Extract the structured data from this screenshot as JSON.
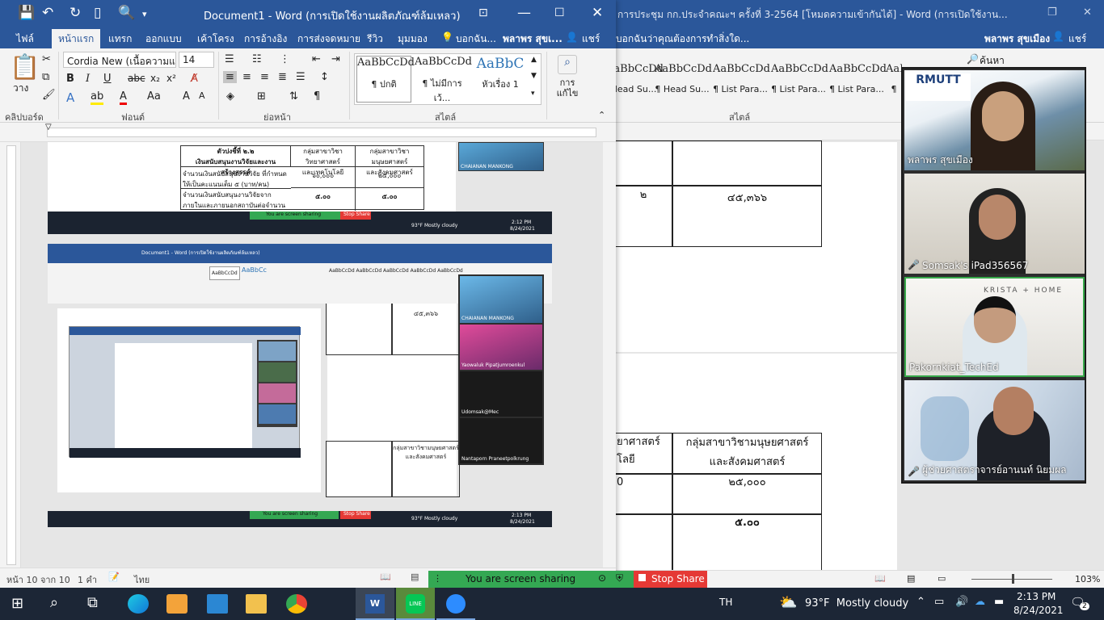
{
  "fg_window": {
    "title": "Document1 - Word (การเปิดใช้งานผลิตภัณฑ์ล้มเหลว)",
    "tabs": [
      "ไฟล์",
      "หน้าแรก",
      "แทรก",
      "ออกแบบ",
      "เค้าโครง",
      "การอ้างอิง",
      "การส่งจดหมาย",
      "รีวิว",
      "มุมมอง",
      "บอกฉัน...",
      "พลาพร สุขเ...",
      "แชร์"
    ],
    "font_name": "Cordia New (เนื้อความแบบ",
    "font_size": "14",
    "groups": [
      "คลิปบอร์ด",
      "ฟอนต์",
      "ย่อหน้า",
      "สไตล์",
      "การแก้ไข"
    ],
    "paste_label": "วาง",
    "styles": [
      {
        "sample": "AaBbCcDd",
        "name": "¶ ปกติ"
      },
      {
        "sample": "AaBbCcDd",
        "name": "¶ ไม่มีการเว้..."
      },
      {
        "sample": "AaBbC",
        "name": "หัวเรื่อง 1"
      }
    ],
    "editing_label": "การ แก้ไข",
    "status": {
      "page": "หน้า 10 จาก 10",
      "words": "1 คำ",
      "lang": "ไทย"
    }
  },
  "bg_window": {
    "title": "การประชุม กก.ประจำคณะฯ ครั้งที่ 3-2564 [โหมดความเข้ากันได้] - Word (การเปิดใช้งาน...",
    "tell_me": "บอกฉันว่าคุณต้องการทำสิ่งใด...",
    "user": "พลาพร สุขเมือง",
    "share": "แชร์",
    "search": "ค้นหา",
    "styles": [
      {
        "sample": "AaBbCcDd",
        "name": "Head Su..."
      },
      {
        "sample": "AaBbCcDd",
        "name": "¶ Head Su..."
      },
      {
        "sample": "AaBbCcDd",
        "name": "¶ List Para..."
      },
      {
        "sample": "AaBbCcDd",
        "name": "¶ List Para..."
      },
      {
        "sample": "AaBbCcDd",
        "name": "¶ List Para..."
      },
      {
        "sample": "AaBbCcDd",
        "name": "¶ ..."
      }
    ],
    "group_style": "สไตล์",
    "table_top": {
      "c1": "๒",
      "c2": "๔๕,๓๖๖"
    },
    "table_bottom": {
      "h1": "ยาศาสตร์\nโลยี",
      "h2": "กลุ่มสาขาวิชามนุษยศาสตร์\nและสังคมศาสตร์",
      "r1c1": "0",
      "r1c2": "๒๕,๐๐๐",
      "r2c2": "๕.๐๐"
    },
    "zoom": "103%"
  },
  "doc_snippet": {
    "header": "ตัวบ่งชี้ที่ ๒.๒\nเงินสนับสนุนงานวิจัยและงานสร้างสรรค์",
    "col1": "กลุ่มสาขาวิชาวิทยาศาสตร์\nและเทคโนโลยี",
    "col2": "กลุ่มสาขาวิชามนุษยศาสตร์\nและสังคมศาสตร์",
    "row1": "จำนวนเงินสนับสนุนงานวิจัย ที่กำหนดให้เป็นคะแนนเต็ม ๕ (บาท/คน)",
    "row1v1": "๖๐,๐๐๐",
    "row1v2": "๒๕,๐๐๐",
    "row2": "จำนวนเงินสนับสนุนงานวิจัยจากภายในและภายนอกสถาบันต่อจำนวนอาจารย์ประจำ/นักวิจัย (ไม่นับรวมที่ลาศึกษาต่อ)",
    "row2v1": "๕.๐๐",
    "row2v2": "๕.๐๐",
    "val45": "๔๕,๓๖๖"
  },
  "video_participants": [
    {
      "name": "พลาพร สุขเมือง",
      "mic_muted": false
    },
    {
      "name": "Somsak's iPad356567",
      "mic_muted": true
    },
    {
      "name": "Pakornkiat_TechEd",
      "mic_muted": false
    },
    {
      "name": "ผู้ช่วยศาสตราจารย์อานนท์ นิยมผล",
      "mic_muted": true
    }
  ],
  "nested_participants": [
    "CHAIANAN MANKONG",
    "Yaowaluk Pipatjumroenkul",
    "Udomsak@Mec",
    "Nantaporn Praneetpolkrung"
  ],
  "share_bar": {
    "sharing": "You are screen sharing",
    "stop": "Stop Share"
  },
  "taskbar": {
    "lang": "TH",
    "weather": "93°F  Mostly cloudy",
    "time": "2:13 PM",
    "date": "8/24/2021",
    "notif": "2",
    "nested_time": "2:12 PM",
    "nested_time2": "2:13 PM",
    "nested_date": "8/24/2021"
  },
  "colors": {
    "word_blue": "#2b579a",
    "share_green": "#34a853",
    "stop_red": "#e53935",
    "taskbar": "#1c2636"
  }
}
